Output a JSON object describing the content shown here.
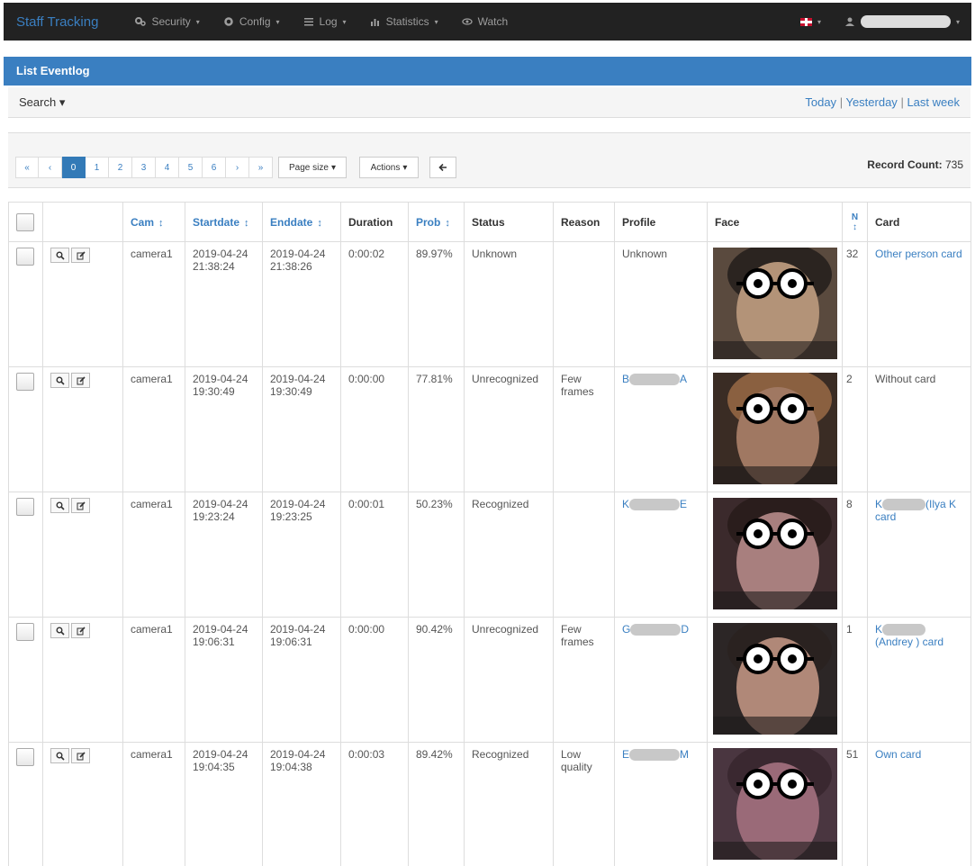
{
  "nav": {
    "brand": "Staff Tracking",
    "menus": [
      {
        "label": "Security",
        "icon": "gears-icon"
      },
      {
        "label": "Config",
        "icon": "gear-icon"
      },
      {
        "label": "Log",
        "icon": "list-icon"
      },
      {
        "label": "Statistics",
        "icon": "bar-chart-icon"
      },
      {
        "label": "Watch",
        "icon": "eye-icon"
      }
    ],
    "language_icon": "uk-flag-icon",
    "user_icon": "user-icon"
  },
  "panel": {
    "title": "List Eventlog"
  },
  "search": {
    "label": "Search",
    "quick_links": [
      "Today",
      "Yesterday",
      "Last week"
    ],
    "separator": "|"
  },
  "toolbar": {
    "pager": [
      "«",
      "‹",
      "0",
      "1",
      "2",
      "3",
      "4",
      "5",
      "6",
      "›",
      "»"
    ],
    "active_page": "0",
    "page_size_label": "Page size",
    "actions_label": "Actions",
    "back_icon": "arrow-left-icon",
    "record_count_label": "Record Count:",
    "record_count": "735"
  },
  "table": {
    "headers": {
      "cam": "Cam",
      "startdate": "Startdate",
      "enddate": "Enddate",
      "duration": "Duration",
      "prob": "Prob",
      "status": "Status",
      "reason": "Reason",
      "profile": "Profile",
      "face": "Face",
      "n": "N",
      "card": "Card"
    },
    "rows": [
      {
        "cam": "camera1",
        "start": "2019-04-24 21:38:24",
        "end": "2019-04-24 21:38:26",
        "duration": "0:00:02",
        "prob": "89.97%",
        "status": "Unknown",
        "reason": "",
        "profile_pre": "Unknown",
        "profile_post": "",
        "n": "32",
        "card_pre": "Other person card",
        "card_post": "",
        "face_bg": "#5a4a3e",
        "skin": "#b39378",
        "hair": "#2b2420"
      },
      {
        "cam": "camera1",
        "start": "2019-04-24 19:30:49",
        "end": "2019-04-24 19:30:49",
        "duration": "0:00:00",
        "prob": "77.81%",
        "status": "Unrecognized",
        "reason": "Few frames",
        "profile_pre": "B",
        "profile_post": "A",
        "n": "2",
        "card_pre": "Without card",
        "card_post": "",
        "face_bg": "#3a2c24",
        "skin": "#a07862",
        "hair": "#8a6040"
      },
      {
        "cam": "camera1",
        "start": "2019-04-24 19:23:24",
        "end": "2019-04-24 19:23:25",
        "duration": "0:00:01",
        "prob": "50.23%",
        "status": "Recognized",
        "reason": "",
        "profile_pre": "K",
        "profile_post": "E",
        "n": "8",
        "card_pre": "K",
        "card_post": "(Ilya K            card",
        "face_bg": "#3b2a2c",
        "skin": "#a87f7e",
        "hair": "#2a1d1c"
      },
      {
        "cam": "camera1",
        "start": "2019-04-24 19:06:31",
        "end": "2019-04-24 19:06:31",
        "duration": "0:00:00",
        "prob": "90.42%",
        "status": "Unrecognized",
        "reason": "Few frames",
        "profile_pre": "G",
        "profile_post": "D",
        "n": "1",
        "card_pre": "K",
        "card_post": "(Andrey                ) card",
        "face_bg": "#2c2626",
        "skin": "#b08878",
        "hair": "#2a2220"
      },
      {
        "cam": "camera1",
        "start": "2019-04-24 19:04:35",
        "end": "2019-04-24 19:04:38",
        "duration": "0:00:03",
        "prob": "89.42%",
        "status": "Recognized",
        "reason": "Low quality",
        "profile_pre": "E",
        "profile_post": "M",
        "n": "51",
        "card_pre": "Own card",
        "card_post": "",
        "face_bg": "#4a3640",
        "skin": "#9a6a78",
        "hair": "#3a2830"
      }
    ]
  }
}
